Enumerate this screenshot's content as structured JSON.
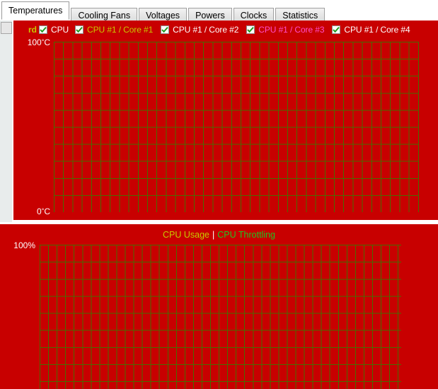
{
  "tabs": [
    {
      "label": "Temperatures",
      "selected": true
    },
    {
      "label": "Cooling Fans",
      "selected": false
    },
    {
      "label": "Voltages",
      "selected": false
    },
    {
      "label": "Powers",
      "selected": false
    },
    {
      "label": "Clocks",
      "selected": false
    },
    {
      "label": "Statistics",
      "selected": false
    }
  ],
  "temperatures_panel": {
    "clipped_label": "rd",
    "legend": [
      {
        "label": "CPU",
        "color": "#ffffff",
        "checked": true
      },
      {
        "label": "CPU #1 / Core #1",
        "color": "#c8c800",
        "checked": true
      },
      {
        "label": "CPU #1 / Core #2",
        "color": "#ffffff",
        "checked": true
      },
      {
        "label": "CPU #1 / Core #3",
        "color": "#ff4ecd",
        "checked": true
      },
      {
        "label": "CPU #1 / Core #4",
        "color": "#ffffff",
        "checked": true
      }
    ],
    "axis_top": "100",
    "axis_top_unit": "C",
    "axis_bottom": "0",
    "axis_bottom_unit": "C",
    "background_color": "#c80000",
    "grid_color": "#4a6b00"
  },
  "usage_panel": {
    "title_usage": "CPU Usage",
    "title_separator": "|",
    "title_throttling": "CPU Throttling",
    "usage_color": "#c8c800",
    "throttling_color": "#22c322",
    "axis_top": "100%",
    "background_color": "#c80000",
    "grid_color": "#4a6b00"
  },
  "scrollbar": {
    "orientation": "vertical",
    "thumb_position": "top"
  },
  "chart_data": [
    {
      "type": "line",
      "title": "Temperatures",
      "ylabel": "",
      "xlabel": "",
      "ylim": [
        0,
        100
      ],
      "ytick_labels": [
        "0°C",
        "100°C"
      ],
      "grid": true,
      "legend_position": "top",
      "series": [
        {
          "name": "CPU",
          "color": "#ffffff",
          "values": []
        },
        {
          "name": "CPU #1 / Core #1",
          "color": "#c8c800",
          "values": []
        },
        {
          "name": "CPU #1 / Core #2",
          "color": "#ffffff",
          "values": []
        },
        {
          "name": "CPU #1 / Core #3",
          "color": "#ff4ecd",
          "values": []
        },
        {
          "name": "CPU #1 / Core #4",
          "color": "#ffffff",
          "values": []
        }
      ]
    },
    {
      "type": "line",
      "title": "CPU Usage | CPU Throttling",
      "ylabel": "",
      "xlabel": "",
      "ylim": [
        0,
        100
      ],
      "ytick_labels": [
        "100%"
      ],
      "grid": true,
      "legend_position": "top",
      "series": [
        {
          "name": "CPU Usage",
          "color": "#c8c800",
          "values": []
        },
        {
          "name": "CPU Throttling",
          "color": "#22c322",
          "values": []
        }
      ]
    }
  ]
}
